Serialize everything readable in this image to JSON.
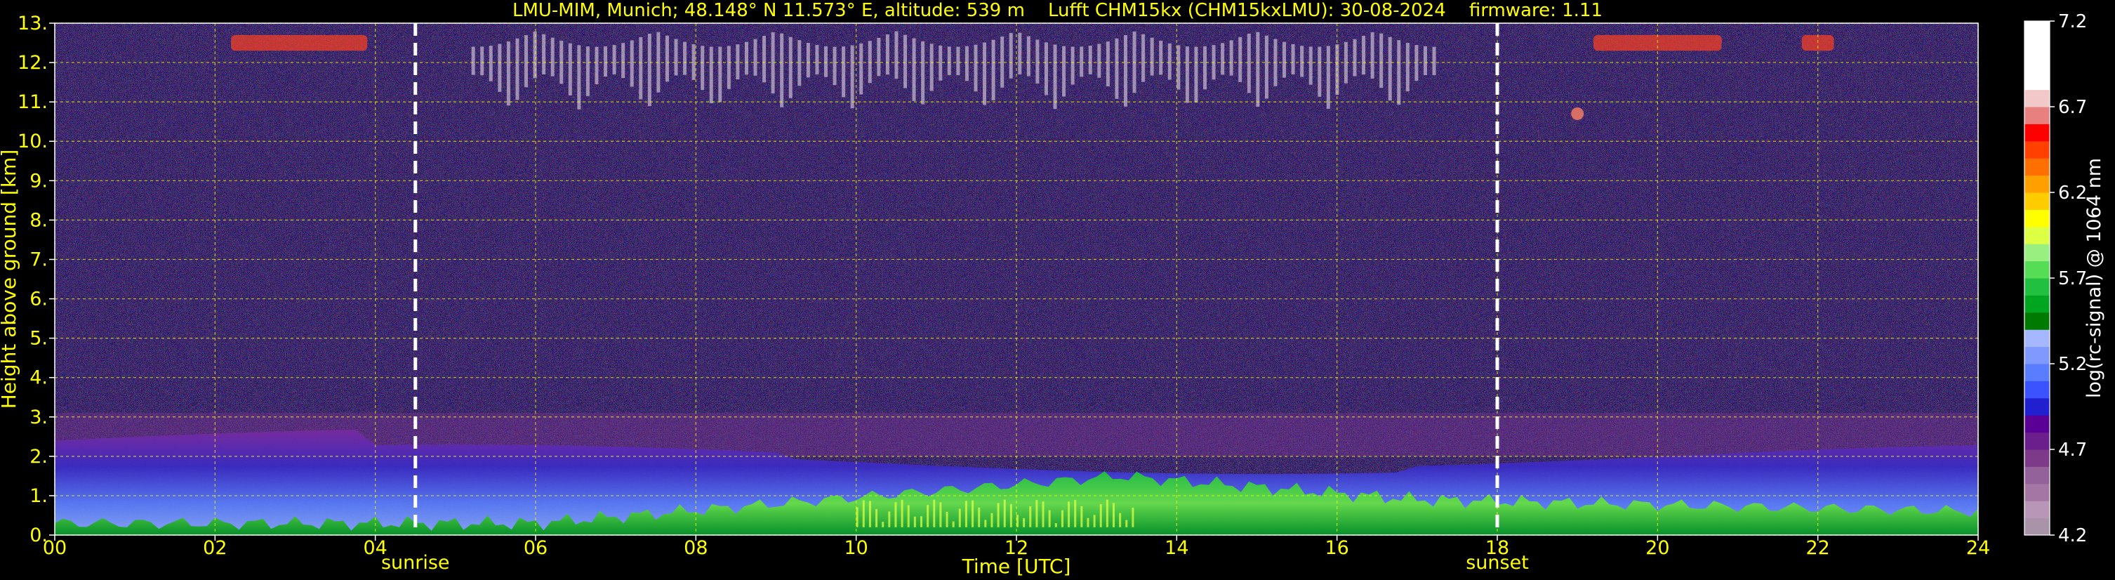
{
  "title": "LMU-MIM, Munich; 48.148° N 11.573° E, altitude: 539 m    Lufft CHM15kx (CHM15kxLMU): 30-08-2024    firmware: 1.11",
  "chart_data": {
    "type": "heatmap",
    "xlabel": "Time [UTC]",
    "ylabel": "Height above ground [km]",
    "xlim": [
      0,
      24
    ],
    "ylim": [
      0,
      13
    ],
    "x_ticks": [
      "00",
      "02",
      "04",
      "06",
      "08",
      "10",
      "12",
      "14",
      "16",
      "18",
      "20",
      "22",
      "24"
    ],
    "y_ticks": [
      "0.",
      "1.",
      "2.",
      "3.",
      "4.",
      "5.",
      "6.",
      "7.",
      "8.",
      "9.",
      "10.",
      "11.",
      "12.",
      "13."
    ],
    "grid": true,
    "annotations": [
      {
        "label": "sunrise",
        "time": 4.5
      },
      {
        "label": "sunset",
        "time": 18.0
      }
    ],
    "colorbar": {
      "label": "log(rc-signal) @ 1064 nm",
      "range": [
        4.2,
        7.2
      ],
      "ticks": [
        "7.2",
        "6.7",
        "6.2",
        "5.7",
        "5.2",
        "4.7",
        "4.2"
      ],
      "colors": [
        "#a893a8",
        "#b796b7",
        "#a376a3",
        "#94629a",
        "#7d3a88",
        "#6a1f8c",
        "#5a0096",
        "#2020d0",
        "#3a52ff",
        "#5a7cff",
        "#7f99ff",
        "#a5b7ff",
        "#007a00",
        "#00a520",
        "#22c040",
        "#55dd55",
        "#99f080",
        "#ddff44",
        "#ffff00",
        "#ffcc00",
        "#ffa000",
        "#ff7000",
        "#ff4000",
        "#ff0000",
        "#e88080",
        "#f2c8c8",
        "#ffffff",
        "#ffffff",
        "#ffffff",
        "#ffffff"
      ]
    },
    "features": {
      "cirrus_cloud_base_km": 10,
      "cirrus_cloud_top_km": 12.8,
      "boundary_layer_top_km": 2.0
    }
  }
}
